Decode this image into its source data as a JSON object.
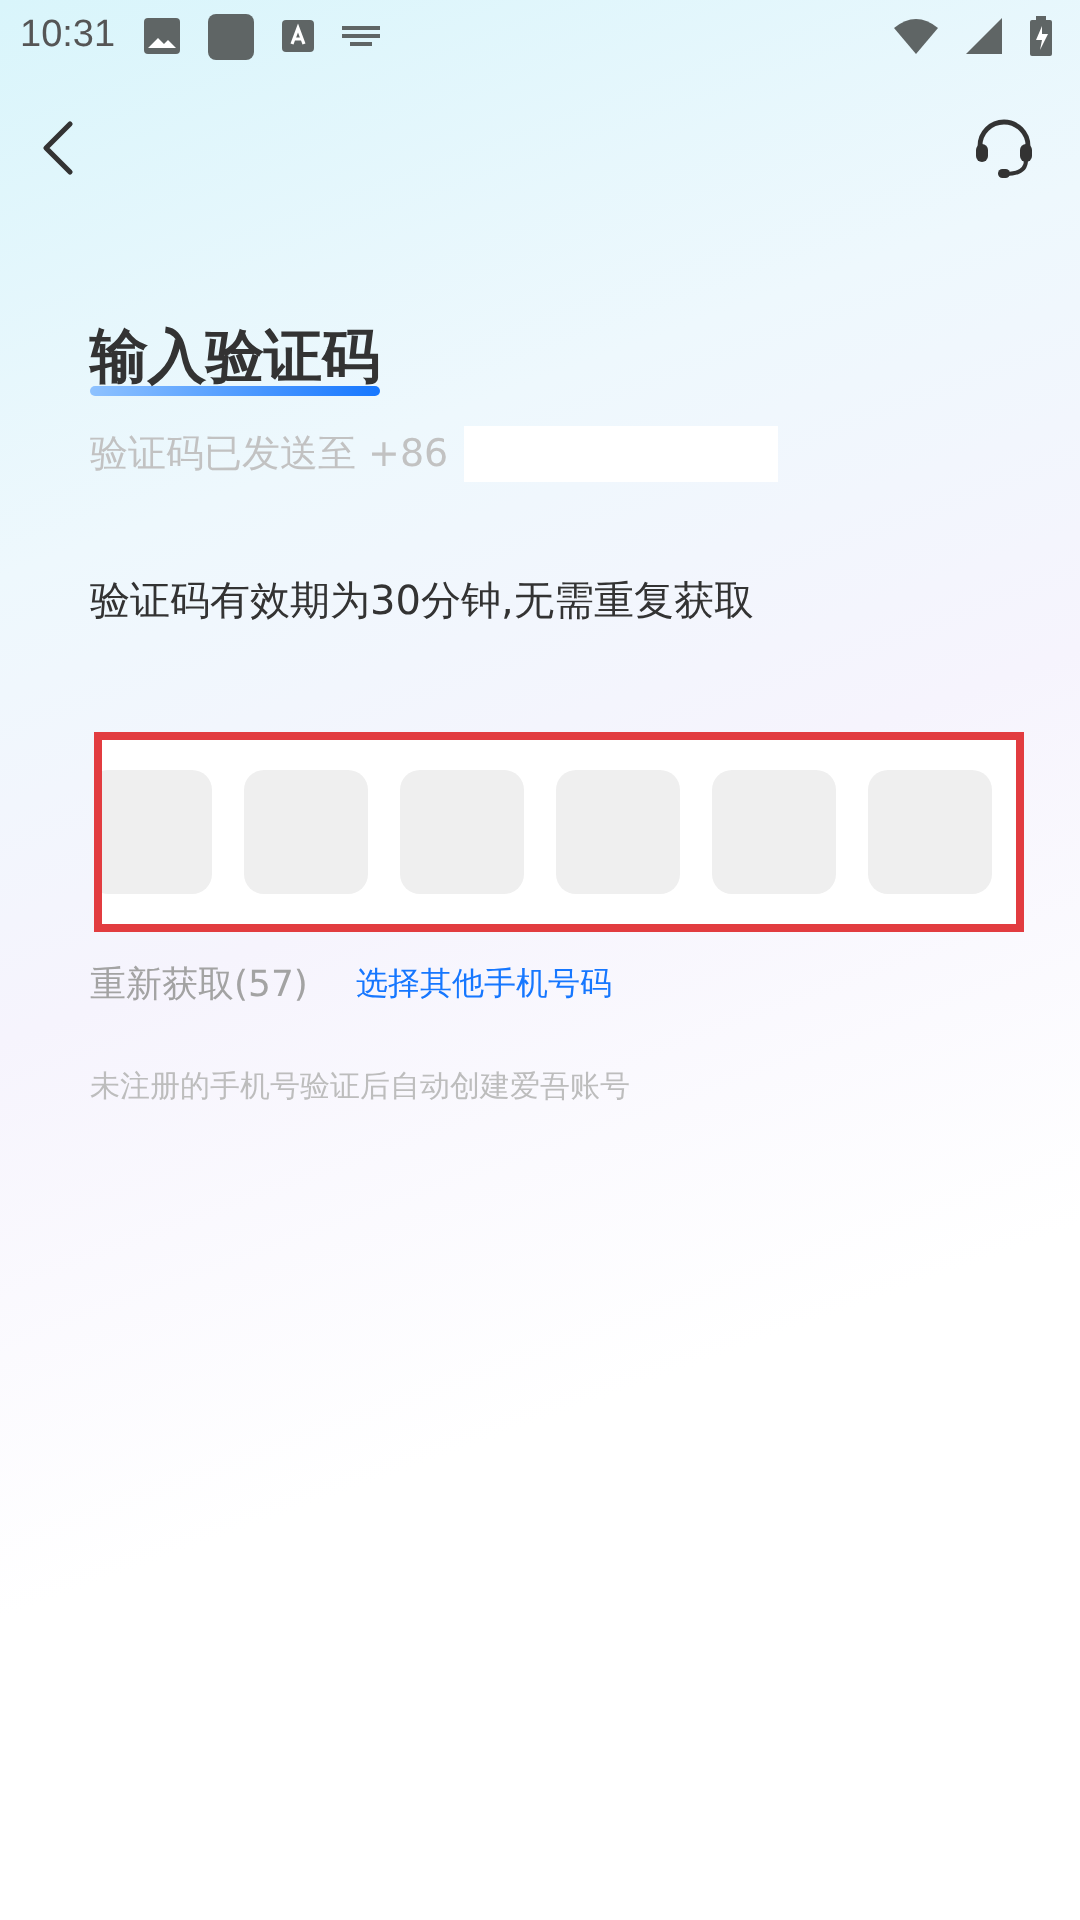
{
  "status_bar": {
    "time": "10:31"
  },
  "title": "输入验证码",
  "sent_to": {
    "label": "验证码已发送至 +86",
    "redacted": true
  },
  "notice": "验证码有效期为30分钟,无需重复获取",
  "code_input": {
    "highlighted": true,
    "cells": [
      {
        "filled": false
      },
      {
        "filled": false
      },
      {
        "filled": false
      },
      {
        "filled": false
      },
      {
        "filled": false
      },
      {
        "filled": false
      }
    ]
  },
  "resend": {
    "label": "重新获取(57)",
    "disabled": true
  },
  "change_number_link": "选择其他手机号码",
  "footnote": "未注册的手机号验证后自动创建爱吾账号"
}
